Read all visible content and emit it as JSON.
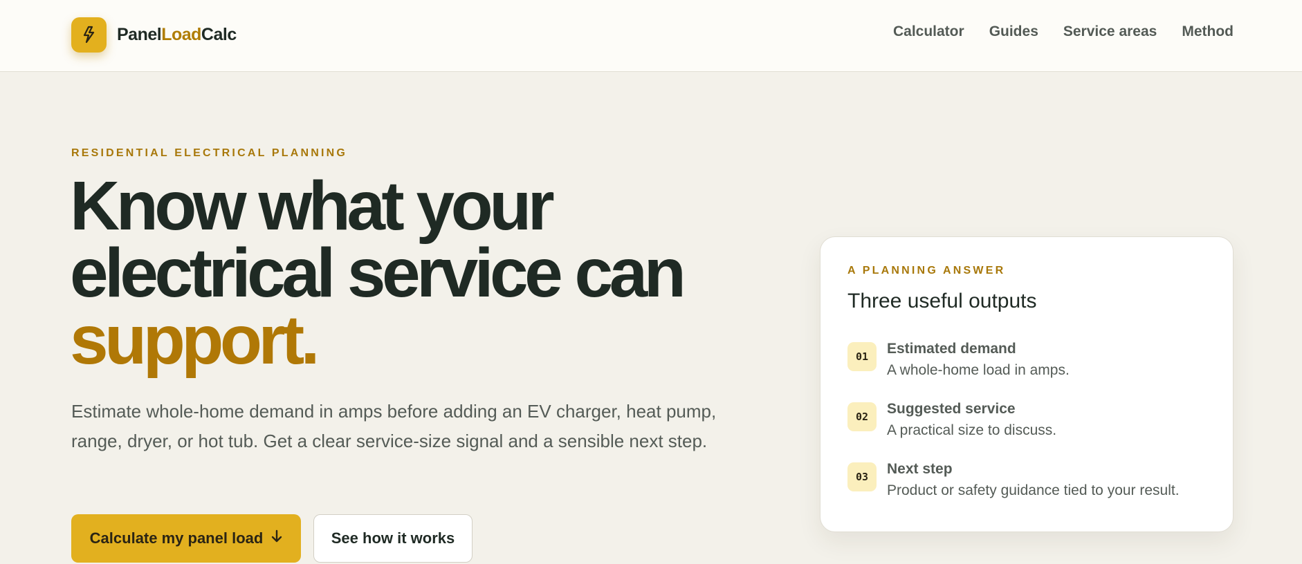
{
  "header": {
    "logo": {
      "part1": "Panel",
      "part2": "Load",
      "part3": "Calc",
      "icon": "lightning-bolt-icon"
    },
    "nav": [
      {
        "label": "Calculator"
      },
      {
        "label": "Guides"
      },
      {
        "label": "Service areas"
      },
      {
        "label": "Method"
      }
    ]
  },
  "hero": {
    "eyebrow": "RESIDENTIAL ELECTRICAL PLANNING",
    "headline": {
      "line1": "Know what your",
      "line2": "electrical service can",
      "accent": "support."
    },
    "lede": "Estimate whole-home demand in amps before adding an EV charger, heat pump, range, dryer, or hot tub. Get a clear service-size signal and a sensible next step.",
    "primary_cta": "Calculate my panel load",
    "primary_cta_icon": "arrow-down-icon",
    "secondary_cta": "See how it works"
  },
  "card": {
    "eyebrow": "A PLANNING ANSWER",
    "title": "Three useful outputs",
    "outputs": [
      {
        "num": "01",
        "title": "Estimated demand",
        "desc": "A whole-home load in amps."
      },
      {
        "num": "02",
        "title": "Suggested service",
        "desc": "A practical size to discuss."
      },
      {
        "num": "03",
        "title": "Next step",
        "desc": "Product or safety guidance tied to your result."
      }
    ]
  },
  "colors": {
    "accent": "#e2b01f",
    "accent_text": "#b07806",
    "text": "#1f2a24",
    "muted": "#545b56",
    "background": "#f3f1ea"
  }
}
